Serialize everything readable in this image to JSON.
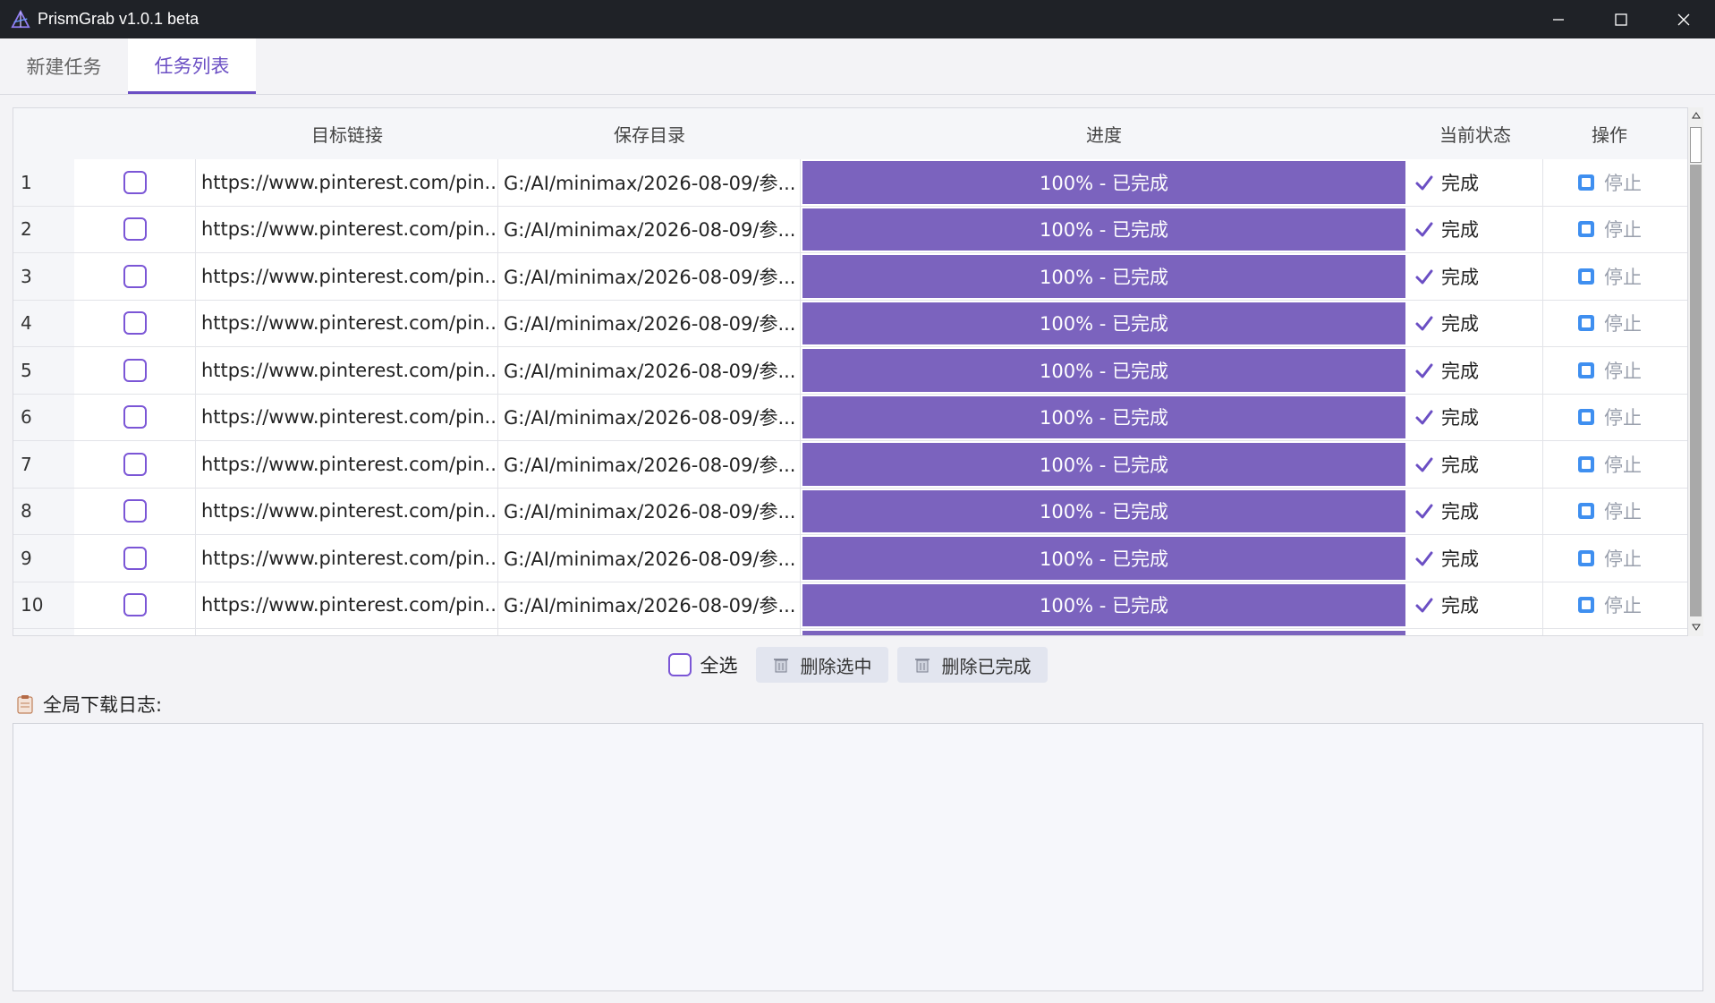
{
  "window": {
    "title": "PrismGrab v1.0.1 beta"
  },
  "tabs": [
    {
      "label": "新建任务",
      "active": false
    },
    {
      "label": "任务列表",
      "active": true
    }
  ],
  "table": {
    "headers": {
      "url": "目标链接",
      "dir": "保存目录",
      "progress": "进度",
      "state": "当前状态",
      "op": "操作"
    },
    "rows": [
      {
        "index": "1",
        "url": "https://www.pinterest.com/pin...",
        "dir": "G:/AI/minimax/2026-08-09/参...",
        "progress": 1.0,
        "progress_text": "100% - 已完成",
        "state": "完成",
        "op": "停止"
      },
      {
        "index": "2",
        "url": "https://www.pinterest.com/pin...",
        "dir": "G:/AI/minimax/2026-08-09/参...",
        "progress": 1.0,
        "progress_text": "100% - 已完成",
        "state": "完成",
        "op": "停止"
      },
      {
        "index": "3",
        "url": "https://www.pinterest.com/pin...",
        "dir": "G:/AI/minimax/2026-08-09/参...",
        "progress": 1.0,
        "progress_text": "100% - 已完成",
        "state": "完成",
        "op": "停止"
      },
      {
        "index": "4",
        "url": "https://www.pinterest.com/pin...",
        "dir": "G:/AI/minimax/2026-08-09/参...",
        "progress": 1.0,
        "progress_text": "100% - 已完成",
        "state": "完成",
        "op": "停止"
      },
      {
        "index": "5",
        "url": "https://www.pinterest.com/pin...",
        "dir": "G:/AI/minimax/2026-08-09/参...",
        "progress": 1.0,
        "progress_text": "100% - 已完成",
        "state": "完成",
        "op": "停止"
      },
      {
        "index": "6",
        "url": "https://www.pinterest.com/pin...",
        "dir": "G:/AI/minimax/2026-08-09/参...",
        "progress": 1.0,
        "progress_text": "100% - 已完成",
        "state": "完成",
        "op": "停止"
      },
      {
        "index": "7",
        "url": "https://www.pinterest.com/pin...",
        "dir": "G:/AI/minimax/2026-08-09/参...",
        "progress": 1.0,
        "progress_text": "100% - 已完成",
        "state": "完成",
        "op": "停止"
      },
      {
        "index": "8",
        "url": "https://www.pinterest.com/pin...",
        "dir": "G:/AI/minimax/2026-08-09/参...",
        "progress": 1.0,
        "progress_text": "100% - 已完成",
        "state": "完成",
        "op": "停止"
      },
      {
        "index": "9",
        "url": "https://www.pinterest.com/pin...",
        "dir": "G:/AI/minimax/2026-08-09/参...",
        "progress": 1.0,
        "progress_text": "100% - 已完成",
        "state": "完成",
        "op": "停止"
      },
      {
        "index": "10",
        "url": "https://www.pinterest.com/pin...",
        "dir": "G:/AI/minimax/2026-08-09/参...",
        "progress": 1.0,
        "progress_text": "100% - 已完成",
        "state": "完成",
        "op": "停止"
      }
    ]
  },
  "actions": {
    "select_all": "全选",
    "delete_selected": "删除选中",
    "delete_completed": "删除已完成"
  },
  "log": {
    "label": "全局下载日志:"
  },
  "icons": {
    "app": "prism-logo-icon",
    "row_state": "checkmark-icon",
    "row_op": "stop-square-icon",
    "delete": "trash-icon",
    "log": "clipboard-icon"
  },
  "colors": {
    "accent": "#6b4fc4",
    "progress_fill": "#7b63be",
    "titlebar": "#1f2227"
  }
}
